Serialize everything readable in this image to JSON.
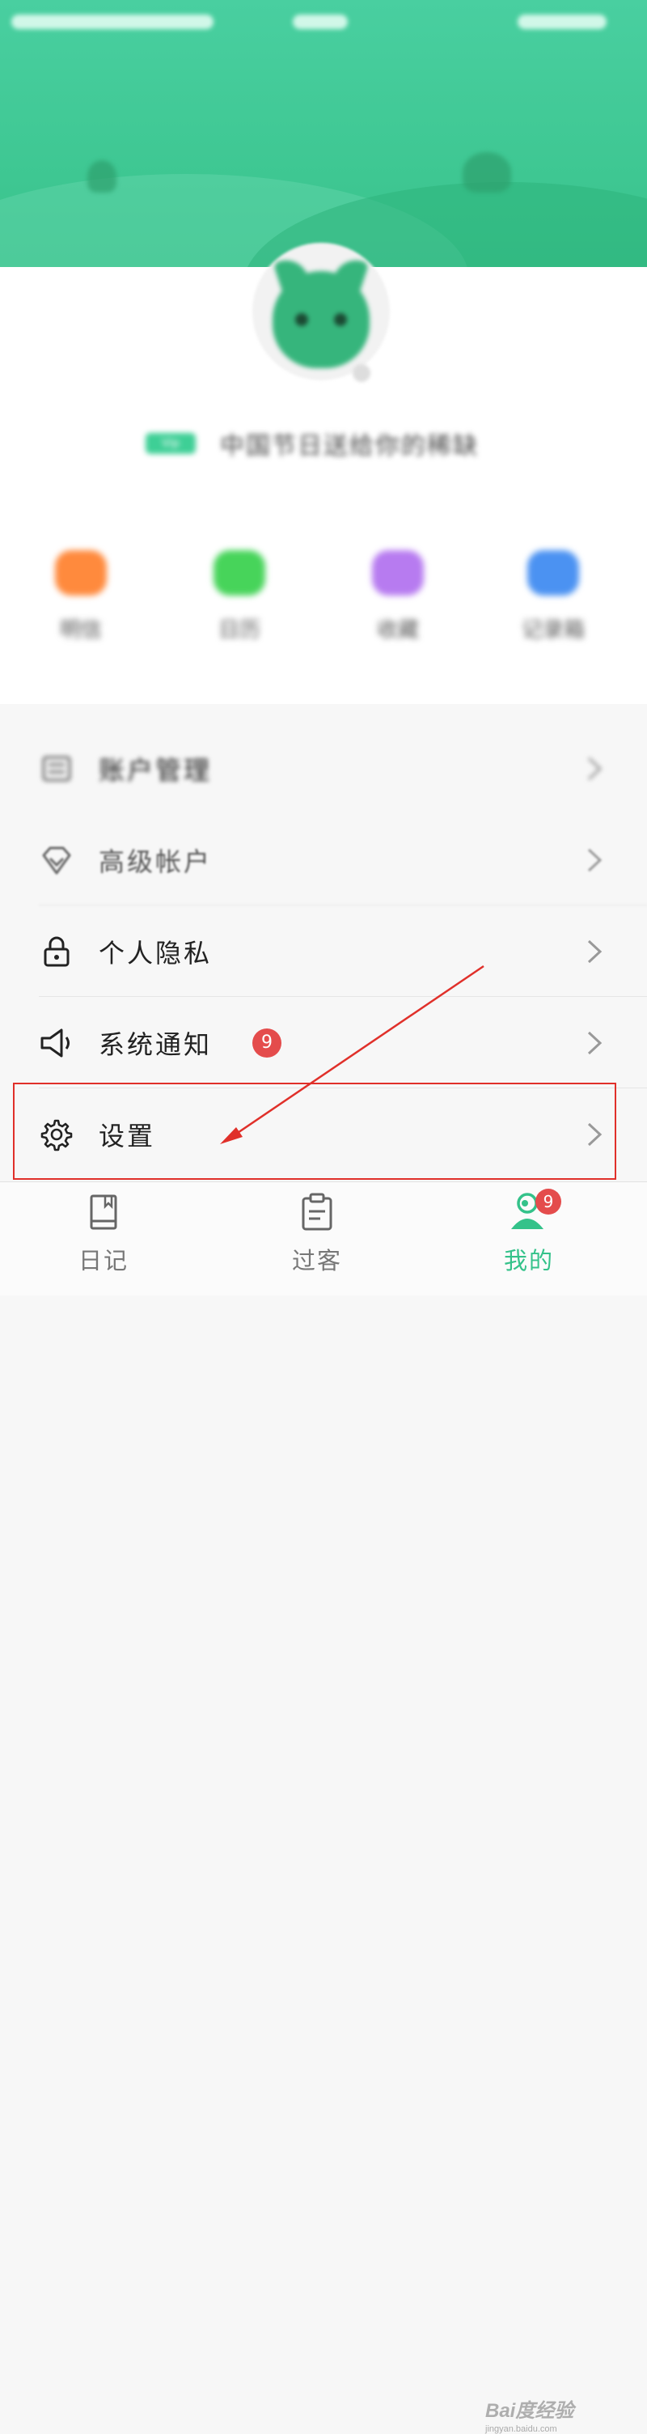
{
  "profile": {
    "vip_tag": "Vip",
    "username": "中国节日送给你的稀缺"
  },
  "quick_actions": [
    {
      "label": "明信",
      "color": "#ff8a3d"
    },
    {
      "label": "日历",
      "color": "#47d45a"
    },
    {
      "label": "收藏",
      "color": "#b77bf0"
    },
    {
      "label": "记录箱",
      "color": "#4b92f2"
    }
  ],
  "menu": {
    "items": [
      {
        "label": "账户管理",
        "icon": "id-card-icon"
      },
      {
        "label": "高级帐户",
        "icon": "diamond-icon"
      },
      {
        "label": "个人隐私",
        "icon": "lock-icon"
      },
      {
        "label": "系统通知",
        "icon": "speaker-icon",
        "badge": "9"
      },
      {
        "label": "设置",
        "icon": "gear-icon"
      }
    ]
  },
  "tabbar": {
    "tabs": [
      {
        "label": "日记",
        "icon": "diary-icon"
      },
      {
        "label": "过客",
        "icon": "clipboard-icon"
      },
      {
        "label": "我的",
        "icon": "profile-icon",
        "badge": "9",
        "active": true
      }
    ]
  },
  "watermark": {
    "text": "Bai度经验",
    "sub": "jingyan.baidu.com"
  },
  "colors": {
    "brand": "#3ec792",
    "badge": "#e44c4c",
    "highlight": "#e0302a"
  }
}
